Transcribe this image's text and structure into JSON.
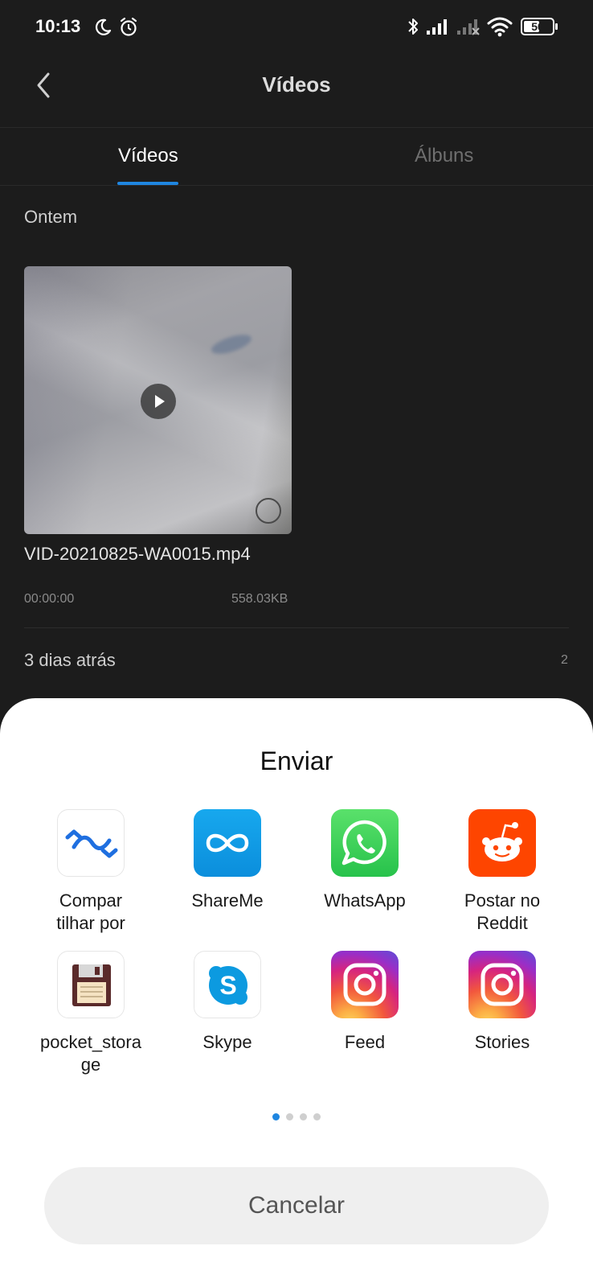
{
  "status_bar": {
    "time": "10:13",
    "battery": "50",
    "battery_level": 0.5,
    "icons": [
      "moon-icon",
      "alarm-icon",
      "bluetooth-icon",
      "signal-icon",
      "signal-no-service-icon",
      "wifi-icon",
      "battery-icon"
    ]
  },
  "header": {
    "title": "Vídeos",
    "back_icon": "chevron-left-icon"
  },
  "tabs": [
    {
      "label": "Vídeos",
      "selected": true
    },
    {
      "label": "Álbuns",
      "selected": false
    }
  ],
  "sections": [
    {
      "label": "Ontem",
      "items": [
        {
          "name": "VID-20210825-WA0015.mp4",
          "duration": "00:00:00",
          "size": "558.03KB"
        }
      ]
    },
    {
      "label": "3 dias atrás",
      "count": "2"
    }
  ],
  "share_sheet": {
    "title": "Enviar",
    "apps": [
      {
        "label": "Compar\ntilhar por",
        "icon": "share-link-icon"
      },
      {
        "label": "ShareMe",
        "icon": "shareme-icon"
      },
      {
        "label": "WhatsApp",
        "icon": "whatsapp-icon"
      },
      {
        "label": "Postar no\nReddit",
        "icon": "reddit-icon"
      },
      {
        "label": "pocket_stora\nge",
        "icon": "floppy-disk-icon"
      },
      {
        "label": "Skype",
        "icon": "skype-icon"
      },
      {
        "label": "Feed",
        "icon": "instagram-icon"
      },
      {
        "label": "Stories",
        "icon": "instagram-icon"
      }
    ],
    "page_count": 4,
    "current_page": 1,
    "cancel_label": "Cancelar"
  },
  "colors": {
    "background": "#1c1c1c",
    "accent": "#1f86e0",
    "sheet": "#ffffff"
  }
}
